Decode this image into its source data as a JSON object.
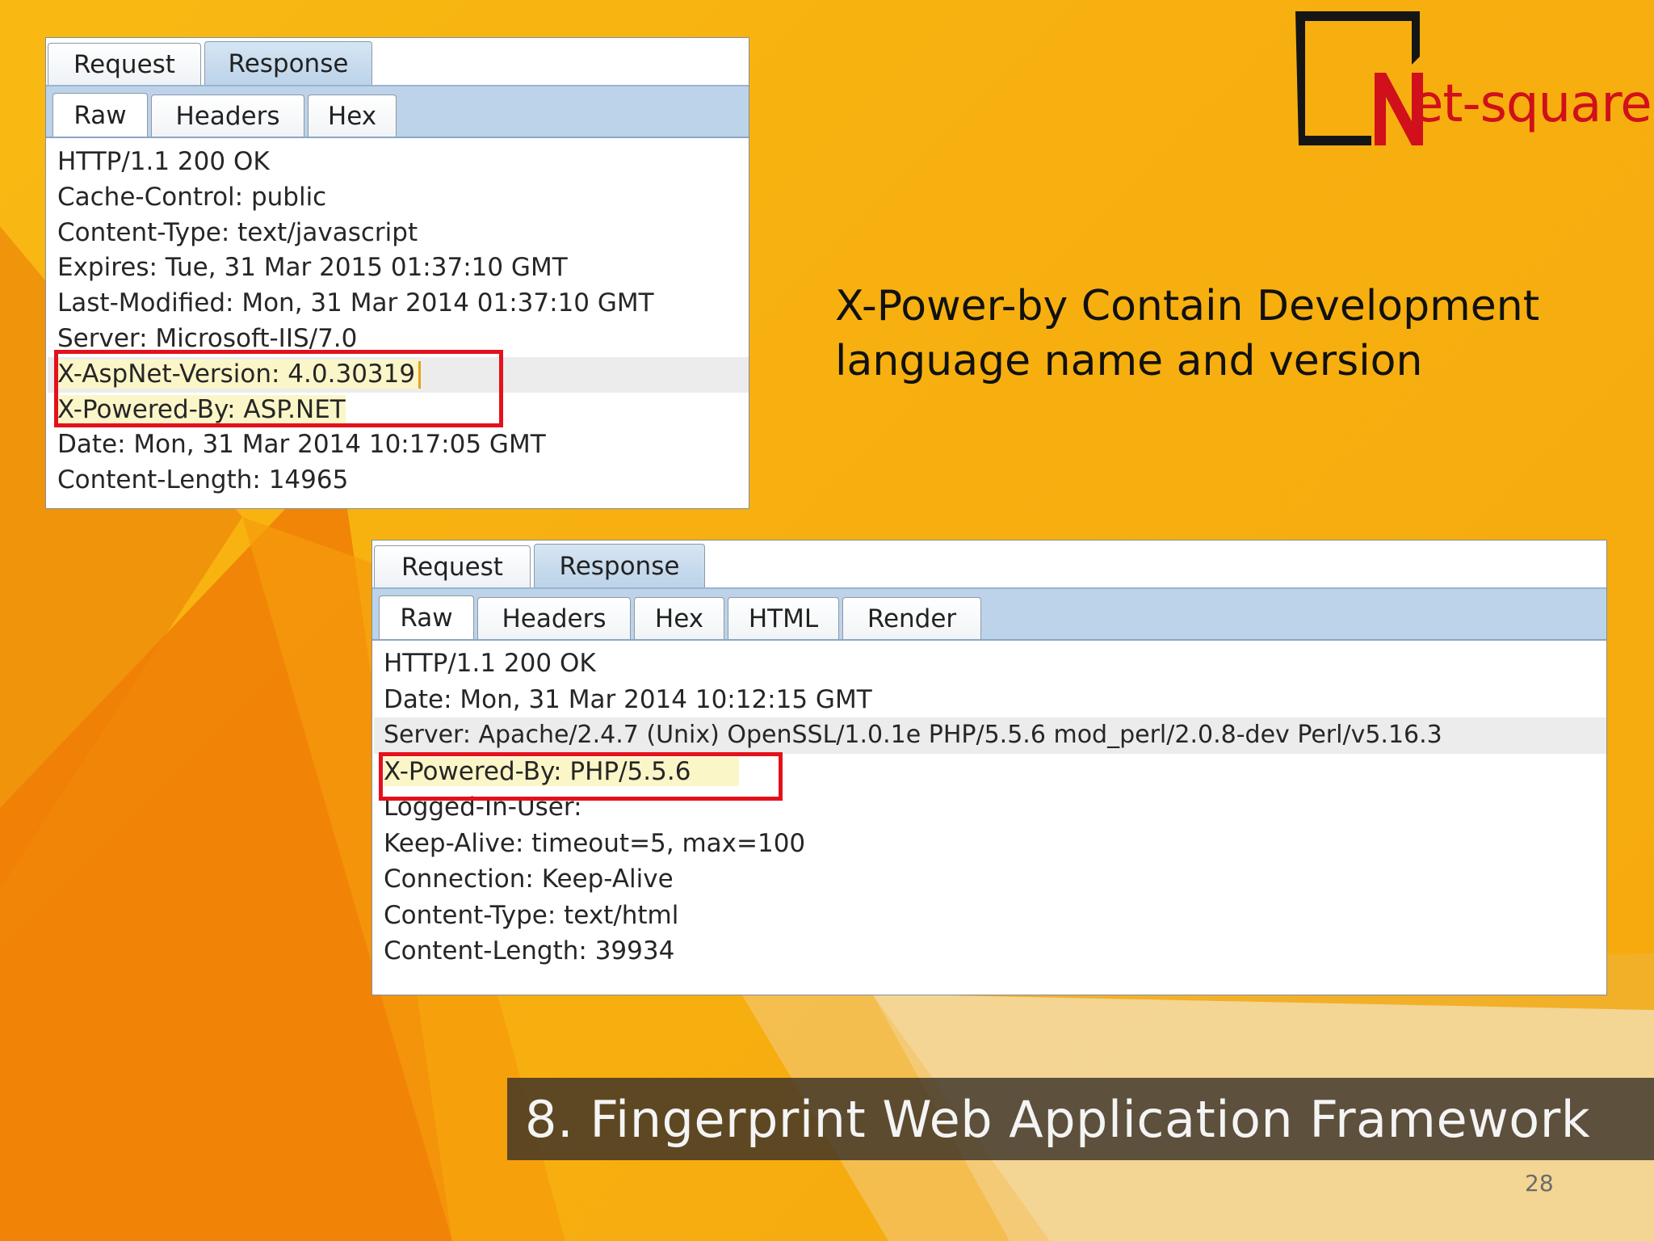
{
  "logo": {
    "wordmark": "et-square",
    "name": "Net-square"
  },
  "description": {
    "line1": "X-Power-by Contain Development",
    "line2": "language name and version"
  },
  "slide_title": "8. Fingerprint Web Application Framework",
  "page_number": "28",
  "panel_top": {
    "tabs": [
      "Request",
      "Response"
    ],
    "active_tab": "Response",
    "subtabs": [
      "Raw",
      "Headers",
      "Hex"
    ],
    "active_subtab": "Raw",
    "lines": [
      "HTTP/1.1 200 OK",
      "Cache-Control: public",
      "Content-Type: text/javascript",
      "Expires: Tue, 31 Mar 2015 01:37:10 GMT",
      "Last-Modified: Mon, 31 Mar 2014 01:37:10 GMT",
      "Server: Microsoft-IIS/7.0",
      "X-AspNet-Version: 4.0.30319",
      "X-Powered-By: ASP.NET",
      "Date: Mon, 31 Mar 2014 10:17:05 GMT",
      "Content-Length: 14965"
    ]
  },
  "panel_bottom": {
    "tabs": [
      "Request",
      "Response"
    ],
    "active_tab": "Response",
    "subtabs": [
      "Raw",
      "Headers",
      "Hex",
      "HTML",
      "Render"
    ],
    "active_subtab": "Raw",
    "lines": [
      "HTTP/1.1 200 OK",
      "Date: Mon, 31 Mar 2014 10:12:15 GMT",
      "Server: Apache/2.4.7 (Unix) OpenSSL/1.0.1e PHP/5.5.6 mod_perl/2.0.8-dev Perl/v5.16.3",
      "X-Powered-By: PHP/5.5.6",
      "Logged-In-User:",
      "Keep-Alive: timeout=5, max=100",
      "Connection: Keep-Alive",
      "Content-Type: text/html",
      "Content-Length: 39934"
    ]
  },
  "colors": {
    "background": "#f7b010",
    "highlight_box": "#e4111b",
    "tab_bar": "#bcd3e9",
    "logo_red": "#d0101a"
  }
}
